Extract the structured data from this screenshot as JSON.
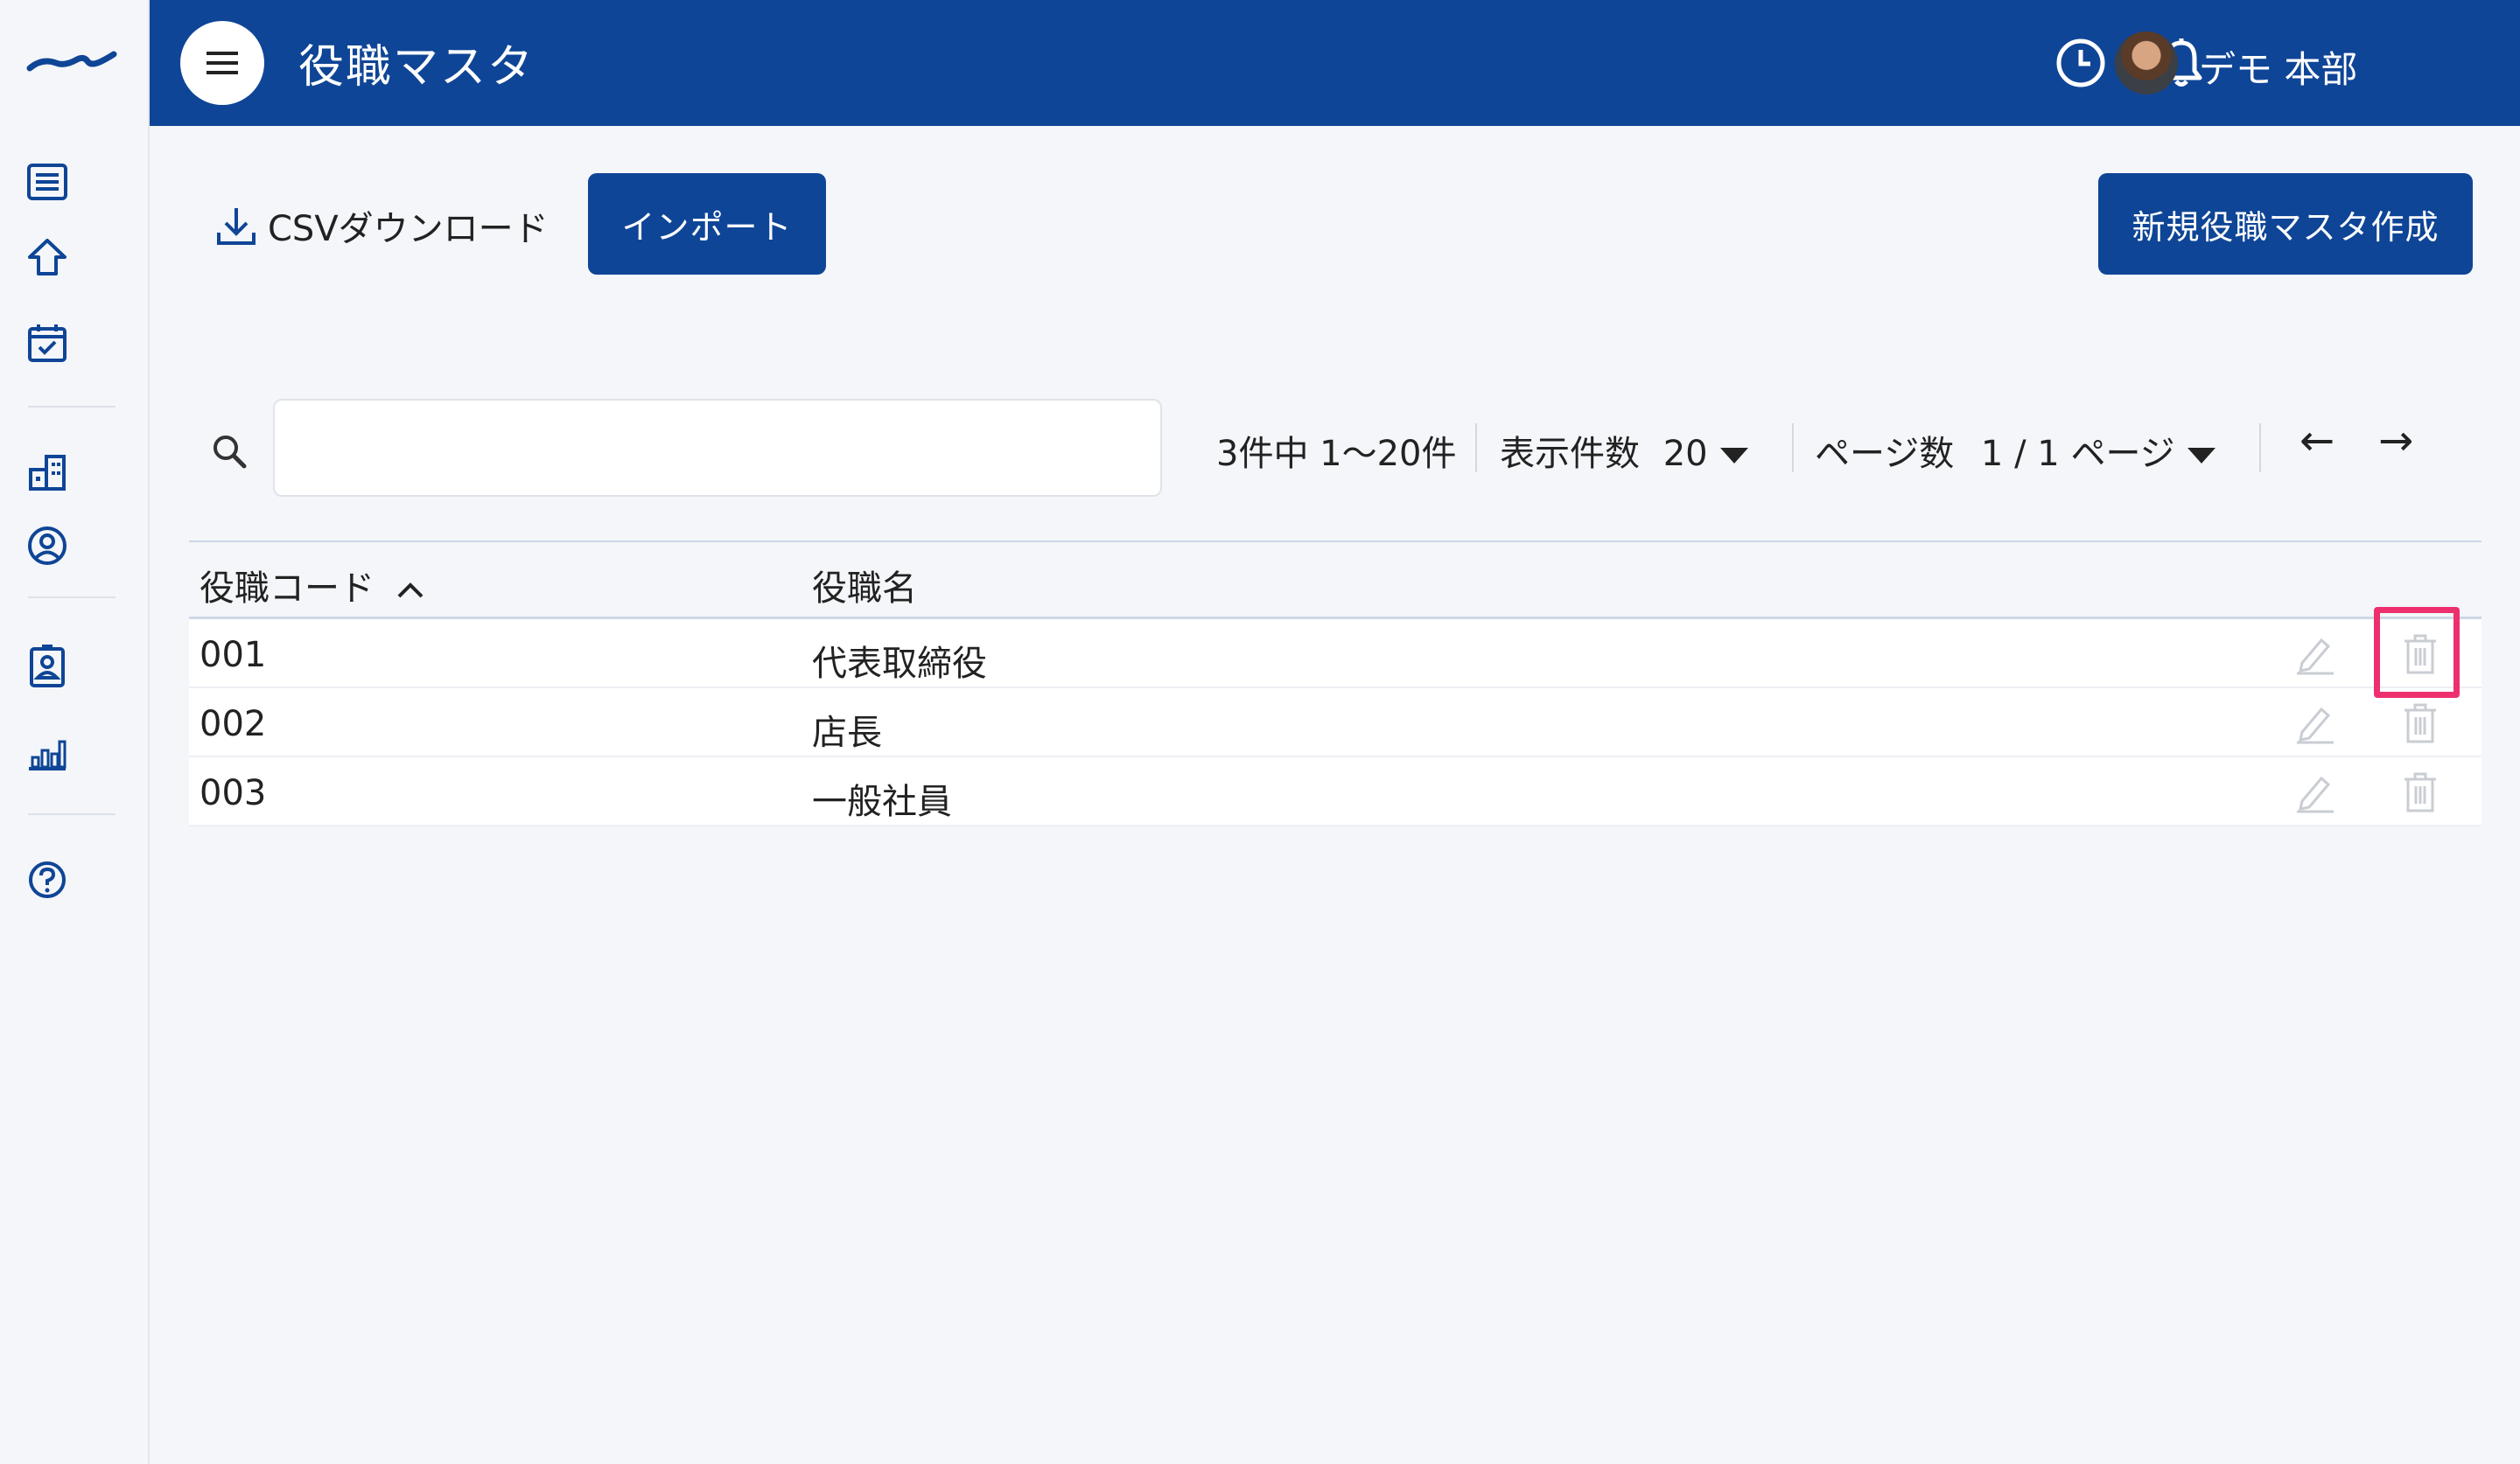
{
  "app": {
    "page_title": "役職マスタ",
    "user_name": "デモ 本部"
  },
  "sidebar": {
    "items": [
      {
        "icon": "list-icon"
      },
      {
        "icon": "home-icon"
      },
      {
        "icon": "calendar-check-icon"
      },
      {
        "icon": "building-icon"
      },
      {
        "icon": "user-circle-icon"
      },
      {
        "icon": "id-card-icon"
      },
      {
        "icon": "bar-chart-icon"
      },
      {
        "icon": "help-icon"
      }
    ]
  },
  "header": {
    "icons": [
      "clock-icon",
      "bell-icon"
    ]
  },
  "toolbar": {
    "csv_label": "CSVダウンロード",
    "import_label": "インポート",
    "new_label": "新規役職マスタ作成"
  },
  "search": {
    "value": "",
    "placeholder": ""
  },
  "pagination": {
    "summary": "3件中 1〜20件",
    "per_page_label": "表示件数",
    "per_page_value": "20",
    "page_label": "ページ数",
    "page_value": "1 / 1 ページ",
    "prev": "←",
    "next": "→"
  },
  "table": {
    "columns": [
      "役職コード",
      "役職名"
    ],
    "sort_indicator": "^",
    "rows": [
      {
        "code": "001",
        "name": "代表取締役"
      },
      {
        "code": "002",
        "name": "店長"
      },
      {
        "code": "003",
        "name": "一般社員"
      }
    ]
  },
  "colors": {
    "brand": "#0f4596",
    "highlight": "#ee2f6e",
    "background": "#f4f6f9"
  }
}
